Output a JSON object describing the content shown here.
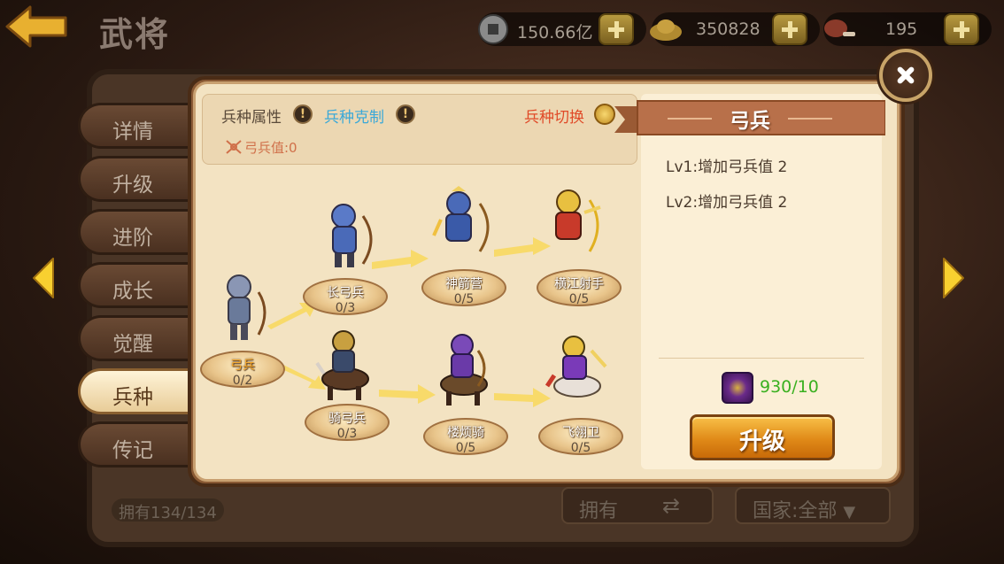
{
  "header": {
    "title": "武将"
  },
  "resources": [
    {
      "icon": "coin-icon",
      "value": "150.66亿"
    },
    {
      "icon": "gold-ingot-icon",
      "value": "350828"
    },
    {
      "icon": "meat-icon",
      "value": "195"
    }
  ],
  "tabs": [
    {
      "label": "详情",
      "active": false
    },
    {
      "label": "升级",
      "active": false
    },
    {
      "label": "进阶",
      "active": false
    },
    {
      "label": "成长",
      "active": false
    },
    {
      "label": "觉醒",
      "active": false
    },
    {
      "label": "兵种",
      "active": true
    },
    {
      "label": "传记",
      "active": false
    }
  ],
  "background": {
    "owned_count": "拥有134/134",
    "owned_button": "拥有",
    "country_filter": "国家:全部"
  },
  "troop": {
    "attribute_label": "兵种属性",
    "counter_label": "兵种克制",
    "switch_label": "兵种切换",
    "archer_value": "弓兵值:0",
    "nodes": {
      "base": {
        "name": "弓兵",
        "progress": "0/2"
      },
      "longbow": {
        "name": "长弓兵",
        "progress": "0/3"
      },
      "divine": {
        "name": "神箭营",
        "progress": "0/5"
      },
      "yangtze": {
        "name": "横江射手",
        "progress": "0/5"
      },
      "horse": {
        "name": "骑弓兵",
        "progress": "0/3"
      },
      "loufan": {
        "name": "楼烦骑",
        "progress": "0/5"
      },
      "feiyu": {
        "name": "飞翎卫",
        "progress": "0/5"
      }
    }
  },
  "detail": {
    "title": "弓兵",
    "levels": [
      "Lv1:增加弓兵值 2",
      "Lv2:增加弓兵值 2"
    ],
    "cost": "930/10",
    "upgrade_label": "升级"
  },
  "colors": {
    "accent_orange": "#e08a18",
    "counter_blue": "#3aa8d8",
    "switch_red": "#e04a28",
    "cost_green": "#3ab020"
  }
}
